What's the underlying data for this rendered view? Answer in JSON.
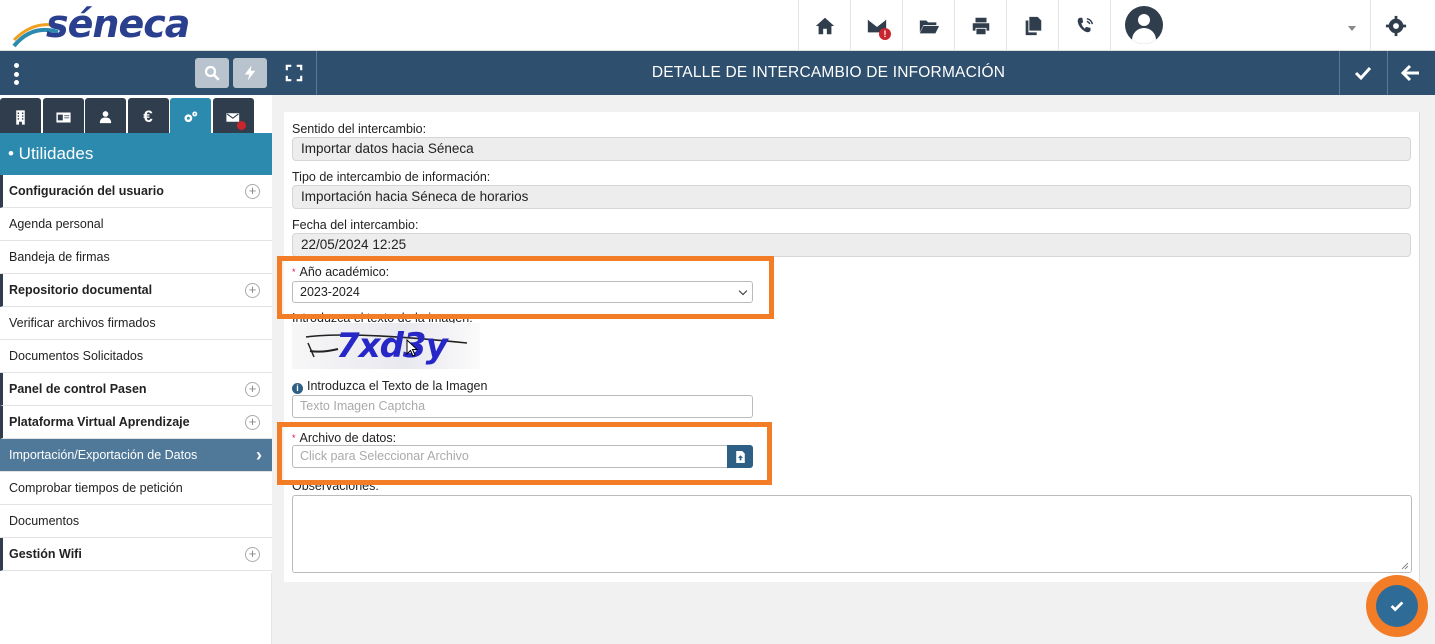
{
  "app": {
    "logo_text": "séneca"
  },
  "header": {
    "title": "DETALLE DE INTERCAMBIO DE INFORMACIÓN"
  },
  "sidebar": {
    "section_title": "• Utilidades",
    "items": [
      {
        "label": "Configuración del usuario",
        "type": "section"
      },
      {
        "label": "Agenda personal",
        "type": "item"
      },
      {
        "label": "Bandeja de firmas",
        "type": "item"
      },
      {
        "label": "Repositorio documental",
        "type": "section"
      },
      {
        "label": "Verificar archivos firmados",
        "type": "item"
      },
      {
        "label": "Documentos Solicitados",
        "type": "item"
      },
      {
        "label": "Panel de control Pasen",
        "type": "section"
      },
      {
        "label": "Plataforma Virtual Aprendizaje",
        "type": "section"
      },
      {
        "label": "Importación/Exportación de Datos",
        "type": "active"
      },
      {
        "label": "Comprobar tiempos de petición",
        "type": "item"
      },
      {
        "label": "Documentos",
        "type": "item"
      },
      {
        "label": "Gestión Wifi",
        "type": "section"
      }
    ],
    "tabs": [
      "building-icon",
      "id-card-icon",
      "users-icon",
      "euro-icon",
      "gears-icon",
      "mail-alert-icon"
    ],
    "tab_euro": "€"
  },
  "form": {
    "sentido_label": "Sentido del intercambio:",
    "sentido_value": "Importar datos hacia Séneca",
    "tipo_label": "Tipo de intercambio de información:",
    "tipo_value": "Importación hacia Séneca de horarios",
    "fecha_label": "Fecha del intercambio:",
    "fecha_value": "22/05/2024 12:25",
    "anio_label": "Año académico:",
    "anio_value": "2023-2024",
    "captcha_label": "Introduzca el texto de la imagen:",
    "captcha_text": "7xd3y",
    "captcha_hint": "Introduzca el Texto de la Imagen",
    "captcha_placeholder": "Texto Imagen Captcha",
    "archivo_label": "Archivo de datos:",
    "archivo_placeholder": "Click para Seleccionar Archivo",
    "observaciones_label": "Observaciones:",
    "required_mark": "*",
    "info_mark": "i"
  },
  "colors": {
    "navy": "#2e4f6d",
    "accent": "#2b8aae",
    "highlight": "#f37c27"
  }
}
